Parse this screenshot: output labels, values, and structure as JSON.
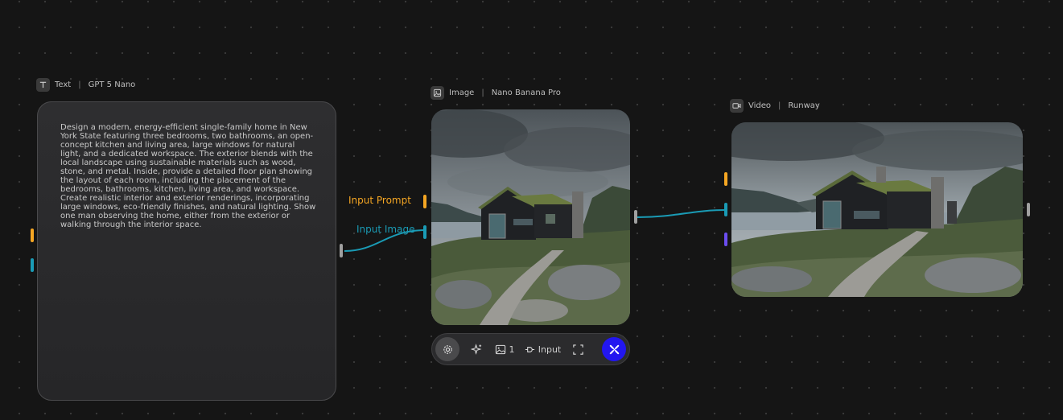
{
  "text_node": {
    "type_label": "Text",
    "separator": "|",
    "model": "GPT 5 Nano",
    "icon": "text-T-icon",
    "prompt": "Design a modern, energy-efficient single-family home in New York State featuring three bedrooms, two bathrooms, an open-concept kitchen and living area, large windows for natural light, and a dedicated workspace. The exterior blends with the local landscape using sustainable materials such as wood, stone, and metal. Inside, provide a detailed floor plan showing the layout of each room, including the placement of the bedrooms, bathrooms, kitchen, living area, and workspace. Create realistic interior and exterior renderings, incorporating large windows, eco-friendly finishes, and natural lighting. Show one man observing the home, either from the exterior or walking through the interior space."
  },
  "image_node": {
    "type_label": "Image",
    "separator": "|",
    "model": "Nano Banana Pro",
    "icon": "image-icon",
    "inputs": [
      {
        "label": "Input Prompt",
        "color": "#f5a623"
      },
      {
        "label": "Input Image",
        "color": "#1a9bb5"
      }
    ]
  },
  "video_node": {
    "type_label": "Video",
    "separator": "|",
    "model": "Runway",
    "icon": "video-camera-icon"
  },
  "toolbar": {
    "image_count": "1",
    "input_label": "Input"
  },
  "colors": {
    "prompt_port": "#f5a623",
    "image_port": "#1a9bb5",
    "extra_port": "#6b4df0",
    "output_port": "#a0a0a0",
    "run_button": "#2216f0"
  }
}
